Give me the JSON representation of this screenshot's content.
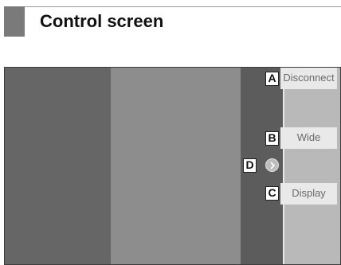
{
  "header": {
    "title": "Control screen"
  },
  "controls": {
    "disconnect": {
      "callout": "A",
      "label": "Disconnect"
    },
    "wide": {
      "callout": "B",
      "label": "Wide"
    },
    "display": {
      "callout": "C",
      "label": "Display"
    },
    "arrow": {
      "callout": "D",
      "icon": "chevron-right-icon"
    }
  },
  "colors": {
    "left_panel": "#666666",
    "mid_panel": "#8d8d8d",
    "strip": "#5c5c5c",
    "right_panel": "#b9b9b9",
    "button_bg": "#e9e9e9"
  }
}
